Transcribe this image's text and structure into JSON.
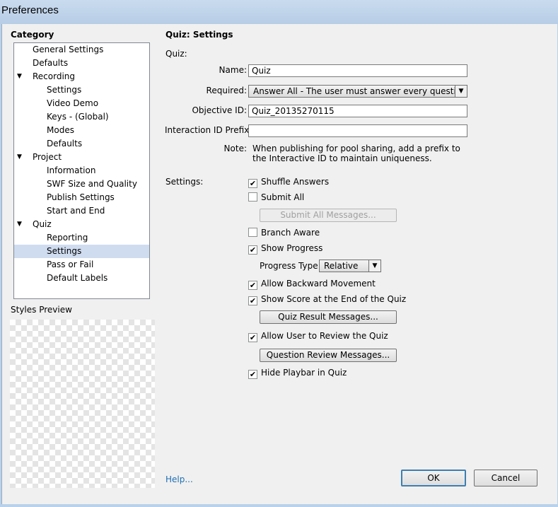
{
  "window": {
    "title": "Preferences"
  },
  "category": {
    "label": "Category",
    "items": [
      {
        "label": "General Settings"
      },
      {
        "label": "Defaults"
      },
      {
        "label": "Recording"
      },
      {
        "label": "Settings"
      },
      {
        "label": "Video Demo"
      },
      {
        "label": "Keys - (Global)"
      },
      {
        "label": "Modes"
      },
      {
        "label": "Defaults"
      },
      {
        "label": "Project"
      },
      {
        "label": "Information"
      },
      {
        "label": "SWF Size and Quality"
      },
      {
        "label": "Publish Settings"
      },
      {
        "label": "Start and End"
      },
      {
        "label": "Quiz"
      },
      {
        "label": "Reporting"
      },
      {
        "label": "Settings"
      },
      {
        "label": "Pass or Fail"
      },
      {
        "label": "Default Labels"
      }
    ],
    "expander": "▼"
  },
  "preview": {
    "label": "Styles Preview"
  },
  "panel": {
    "title": "Quiz: Settings",
    "quiz_label": "Quiz:",
    "name_label": "Name:",
    "name_value": "Quiz",
    "required_label": "Required:",
    "required_value": "Answer All - The user must answer every questio...",
    "objective_label": "Objective ID:",
    "objective_value": "Quiz_20135270115",
    "prefix_label": "Interaction ID Prefix:",
    "prefix_value": "",
    "note_label": "Note:",
    "note_line1": "When publishing for pool sharing, add a prefix to",
    "note_line2": "the Interactive ID to maintain uniqueness.",
    "settings_label": "Settings:",
    "shuffle": "Shuffle Answers",
    "submit_all": "Submit All",
    "submit_all_messages": "Submit All Messages...",
    "branch_aware": "Branch Aware",
    "show_progress": "Show Progress",
    "progress_type_label": "Progress Type:",
    "progress_type_value": "Relative",
    "allow_backward": "Allow Backward Movement",
    "show_score": "Show Score at the End of the Quiz",
    "quiz_result_messages": "Quiz Result Messages...",
    "allow_review": "Allow User to Review the Quiz",
    "question_review_messages": "Question Review Messages...",
    "hide_playbar": "Hide Playbar in Quiz",
    "check": "✔",
    "dropdown_arrow": "▼"
  },
  "footer": {
    "help": "Help...",
    "ok": "OK",
    "cancel": "Cancel"
  }
}
